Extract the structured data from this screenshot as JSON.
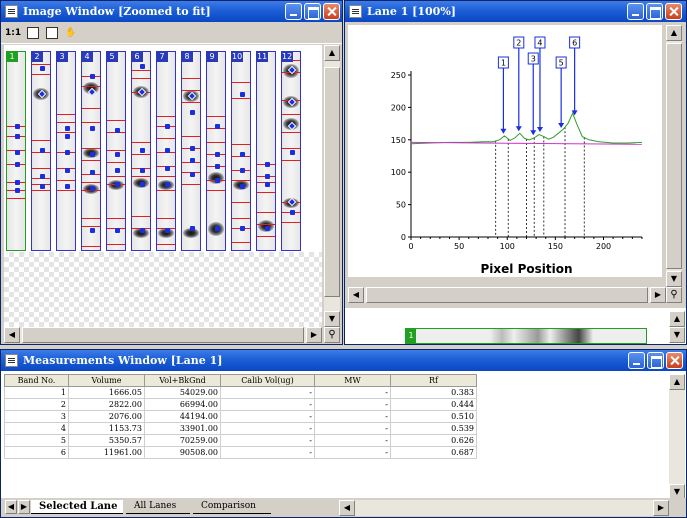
{
  "image_window": {
    "title": "Image Window [Zoomed to fit]",
    "tools": {
      "one_to_one": "1:1"
    },
    "lanes": [
      {
        "label": "1",
        "left": 2,
        "width": 20,
        "selected": true,
        "red": [
          74,
          84,
          98,
          112,
          130,
          138,
          146
        ],
        "bands": [],
        "dots": [
          74,
          84,
          100,
          112,
          130,
          138
        ]
      },
      {
        "label": "2",
        "left": 27,
        "width": 20,
        "red": [
          12,
          22,
          88,
          100,
          116,
          126,
          132,
          138
        ],
        "bands": [
          {
            "y": 36,
            "h": 12
          }
        ],
        "dots": [
          16,
          42,
          98,
          124,
          134
        ],
        "diamonds": [
          42
        ]
      },
      {
        "label": "3",
        "left": 52,
        "width": 20,
        "red": [
          62,
          70,
          80,
          100,
          116,
          128,
          138
        ],
        "bands": [],
        "dots": [
          76,
          84,
          100,
          118,
          134
        ]
      },
      {
        "label": "4",
        "left": 77,
        "width": 20,
        "red": [
          24,
          34,
          56,
          70,
          96,
          108,
          122,
          130,
          138,
          166,
          174,
          194
        ],
        "bands": [
          {
            "y": 30,
            "h": 12
          },
          {
            "y": 96,
            "h": 10
          },
          {
            "y": 132,
            "h": 10
          }
        ],
        "dots": [
          24,
          40,
          76,
          102,
          120,
          136,
          178
        ],
        "diamonds": [
          40
        ]
      },
      {
        "label": "5",
        "left": 102,
        "width": 20,
        "red": [
          68,
          80,
          98,
          110,
          124,
          132,
          166,
          176,
          192
        ],
        "bands": [
          {
            "y": 128,
            "h": 10
          }
        ],
        "dots": [
          78,
          102,
          118,
          132,
          178
        ]
      },
      {
        "label": "6",
        "left": 127,
        "width": 20,
        "red": [
          18,
          26,
          40,
          90,
          102,
          116,
          124,
          164,
          176
        ],
        "bands": [
          {
            "y": 34,
            "h": 12
          },
          {
            "y": 126,
            "h": 10
          },
          {
            "y": 176,
            "h": 10
          }
        ],
        "dots": [
          14,
          40,
          98,
          118,
          132,
          178
        ],
        "diamonds": [
          40
        ]
      },
      {
        "label": "7",
        "left": 152,
        "width": 20,
        "red": [
          64,
          74,
          86,
          100,
          114,
          124,
          138,
          166,
          176,
          192
        ],
        "bands": [
          {
            "y": 128,
            "h": 10
          },
          {
            "y": 176,
            "h": 10
          }
        ],
        "dots": [
          74,
          98,
          116,
          132,
          178
        ]
      },
      {
        "label": "8",
        "left": 177,
        "width": 20,
        "red": [
          26,
          38,
          50,
          84,
          96,
          110,
          120,
          132
        ],
        "bands": [
          {
            "y": 38,
            "h": 12
          },
          {
            "y": 176,
            "h": 10
          }
        ],
        "dots": [
          44,
          60,
          96,
          108,
          122,
          176
        ],
        "diamonds": [
          44
        ]
      },
      {
        "label": "9",
        "left": 202,
        "width": 20,
        "red": [
          64,
          76,
          90,
          102,
          114,
          128,
          138
        ],
        "bands": [
          {
            "y": 120,
            "h": 12
          },
          {
            "y": 170,
            "h": 14
          }
        ],
        "dots": [
          74,
          102,
          114,
          128,
          176
        ]
      },
      {
        "label": "10",
        "left": 227,
        "width": 20,
        "red": [
          30,
          46,
          92,
          104,
          118,
          128,
          150,
          166,
          176,
          190
        ],
        "bands": [
          {
            "y": 128,
            "h": 10
          }
        ],
        "dots": [
          42,
          102,
          118,
          134,
          176
        ]
      },
      {
        "label": "11",
        "left": 252,
        "width": 20,
        "red": [
          112,
          124,
          130,
          140,
          160,
          172,
          184
        ],
        "bands": [
          {
            "y": 168,
            "h": 12
          }
        ],
        "dots": [
          112,
          124,
          132,
          176
        ]
      },
      {
        "label": "12",
        "left": 277,
        "width": 20,
        "red": [
          8,
          20,
          48,
          62,
          80,
          96,
          108,
          150,
          160,
          170
        ],
        "bands": [
          {
            "y": 12,
            "h": 14
          },
          {
            "y": 44,
            "h": 12
          },
          {
            "y": 66,
            "h": 12
          },
          {
            "y": 146,
            "h": 10
          }
        ],
        "dots": [
          18,
          50,
          74,
          100,
          150,
          160
        ],
        "diamonds": [
          18,
          50,
          74,
          150
        ]
      }
    ]
  },
  "lane_window": {
    "title": "Lane 1 [100%]",
    "strip_label": "1"
  },
  "chart_data": {
    "type": "line",
    "title": "",
    "xlabel": "Pixel Position",
    "ylabel": "",
    "xlim": [
      0,
      240
    ],
    "ylim": [
      0,
      250
    ],
    "xticks": [
      0,
      50,
      100,
      150,
      200
    ],
    "yticks": [
      0,
      50,
      100,
      150,
      200,
      250
    ],
    "series": [
      {
        "color": "#2ea02e",
        "x": [
          0,
          20,
          40,
          60,
          75,
          85,
          92,
          97,
          103,
          108,
          113,
          118,
          123,
          128,
          133,
          138,
          143,
          148,
          153,
          158,
          163,
          168,
          172,
          178,
          185,
          195,
          210,
          225,
          240
        ],
        "y": [
          144,
          145,
          146,
          146,
          147,
          147,
          150,
          156,
          149,
          153,
          160,
          152,
          150,
          153,
          158,
          155,
          151,
          154,
          160,
          166,
          175,
          191,
          175,
          155,
          150,
          147,
          145,
          145,
          146
        ]
      },
      {
        "color": "#cc33cc",
        "x": [
          0,
          240
        ],
        "y": [
          146,
          143
        ]
      }
    ],
    "peaks": [
      {
        "label": "1",
        "x": 96
      },
      {
        "label": "2",
        "x": 112
      },
      {
        "label": "3",
        "x": 127
      },
      {
        "label": "4",
        "x": 134
      },
      {
        "label": "5",
        "x": 156
      },
      {
        "label": "6",
        "x": 170
      }
    ],
    "dashed_x": [
      88,
      101,
      120,
      128,
      138,
      160,
      180
    ],
    "grid": false
  },
  "measurements_window": {
    "title": "Measurements Window [Lane 1]",
    "columns": [
      "Band No.",
      "Volume",
      "Vol+BkGnd",
      "Calib Vol(ug)",
      "MW",
      "Rf"
    ],
    "rows": [
      [
        "1",
        "1666.05",
        "54029.00",
        "-",
        "-",
        "0.383"
      ],
      [
        "2",
        "2822.00",
        "66994.00",
        "-",
        "-",
        "0.444"
      ],
      [
        "3",
        "2076.00",
        "44194.00",
        "-",
        "-",
        "0.510"
      ],
      [
        "4",
        "1153.73",
        "33901.00",
        "-",
        "-",
        "0.539"
      ],
      [
        "5",
        "5350.57",
        "70259.00",
        "-",
        "-",
        "0.626"
      ],
      [
        "6",
        "11961.00",
        "90508.00",
        "-",
        "-",
        "0.687"
      ]
    ],
    "tabs": [
      "Selected Lane",
      "All Lanes",
      "Comparison"
    ]
  }
}
